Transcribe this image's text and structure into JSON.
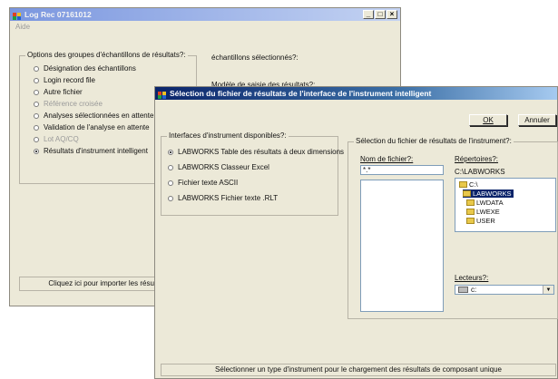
{
  "back_window": {
    "title": "Log Rec 07161012",
    "menu": "Aide",
    "group_label": "Options des groupes d'échantillons de résultats?:",
    "options": [
      {
        "label": "Désignation des échantillons",
        "enabled": true,
        "selected": false
      },
      {
        "label": "Login record file",
        "enabled": true,
        "selected": false
      },
      {
        "label": "Autre fichier",
        "enabled": true,
        "selected": false
      },
      {
        "label": "Référence croisée",
        "enabled": false,
        "selected": false
      },
      {
        "label": "Analyses sélectionnées en attente",
        "enabled": true,
        "selected": false
      },
      {
        "label": "Validation de l'analyse en attente",
        "enabled": true,
        "selected": false
      },
      {
        "label": "Lot AQ/CQ",
        "enabled": false,
        "selected": false
      },
      {
        "label": "Résultats d'instrument intelligent",
        "enabled": true,
        "selected": true
      }
    ],
    "selected_samples_label": "échantillons sélectionnés?:",
    "input_model_label": "Modèle de saisie des résultats?:",
    "status": "Cliquez ici pour importer les résultats"
  },
  "front_window": {
    "title": "Sélection du fichier de résultats de l'interface de l'instrument intelligent",
    "ok_label": "OK",
    "cancel_label": "Annuler",
    "interfaces_group_label": "Interfaces d'instrument disponibles?:",
    "interfaces": [
      {
        "label": "LABWORKS Table des résultats à deux dimensions",
        "selected": true
      },
      {
        "label": "LABWORKS Classeur Excel",
        "selected": false
      },
      {
        "label": "Fichier texte ASCII",
        "selected": false
      },
      {
        "label": "LABWORKS Fichier texte .RLT",
        "selected": false
      }
    ],
    "file_group_label": "Sélection du fichier de résultats de l'instrument?:",
    "filename_label": "Nom de fichier?:",
    "filename_value": "*.*",
    "directories_label": "Répertoires?:",
    "current_dir": "C:\\LABWORKS",
    "tree": [
      {
        "label": "C:\\",
        "selected": false,
        "level": 0
      },
      {
        "label": "LABWORKS",
        "selected": true,
        "level": 1
      },
      {
        "label": "LWDATA",
        "selected": false,
        "level": 2
      },
      {
        "label": "LWEXE",
        "selected": false,
        "level": 2
      },
      {
        "label": "USER",
        "selected": false,
        "level": 2
      }
    ],
    "drives_label": "Lecteurs?:",
    "drive_value": "c:",
    "status": "Sélectionner un type d'instrument pour le chargement des résultats de composant unique"
  }
}
